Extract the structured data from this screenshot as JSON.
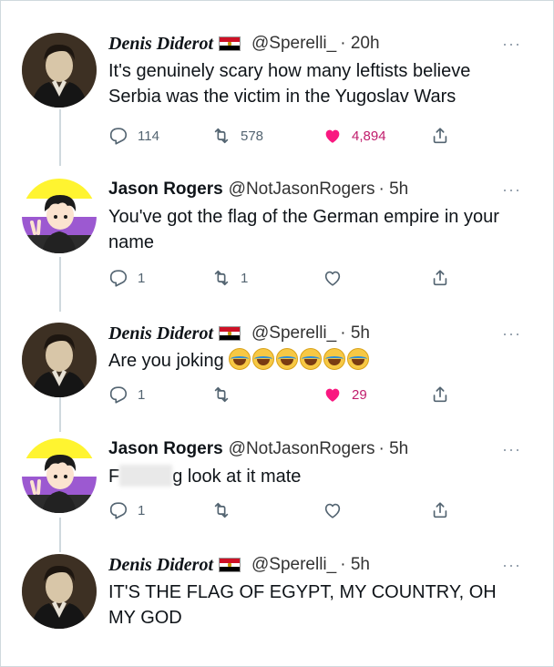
{
  "tweets": [
    {
      "name": "Denis Diderot",
      "handle": "@Sperelli_",
      "time": "· 20h",
      "more": "···",
      "text": "It's genuinely scary how many leftists believe Serbia was the victim in the Yugoslav Wars",
      "replies": "114",
      "retweets": "578",
      "likes": "4,894"
    },
    {
      "name": "Jason Rogers",
      "handle": "@NotJasonRogers",
      "time": "· 5h",
      "more": "···",
      "text": "You've got the flag of the German empire in your name",
      "replies": "1",
      "retweets": "1",
      "likes": ""
    },
    {
      "name": "Denis Diderot",
      "handle": "@Sperelli_",
      "time": "· 5h",
      "more": "···",
      "text": "Are you joking",
      "replies": "1",
      "retweets": "",
      "likes": "29"
    },
    {
      "name": "Jason Rogers",
      "handle": "@NotJasonRogers",
      "time": "· 5h",
      "more": "···",
      "text_start": "F",
      "text_end": "g look at it mate",
      "replies": "1",
      "retweets": "",
      "likes": ""
    },
    {
      "name": "Denis Diderot",
      "handle": "@Sperelli_",
      "time": "· 5h",
      "more": "···",
      "text": "IT'S THE FLAG OF EGYPT, MY COUNTRY, OH MY GOD"
    }
  ],
  "icons": {
    "reply": "reply-icon",
    "retweet": "retweet-icon",
    "like": "heart-icon",
    "share": "share-icon",
    "flag": "egypt-flag-icon",
    "emoji": "face-with-tears-of-joy-icon"
  },
  "colors": {
    "like_active": "#f91880",
    "like_count": "#c01c6c",
    "muted": "#536471",
    "thread": "#cfd9de"
  }
}
